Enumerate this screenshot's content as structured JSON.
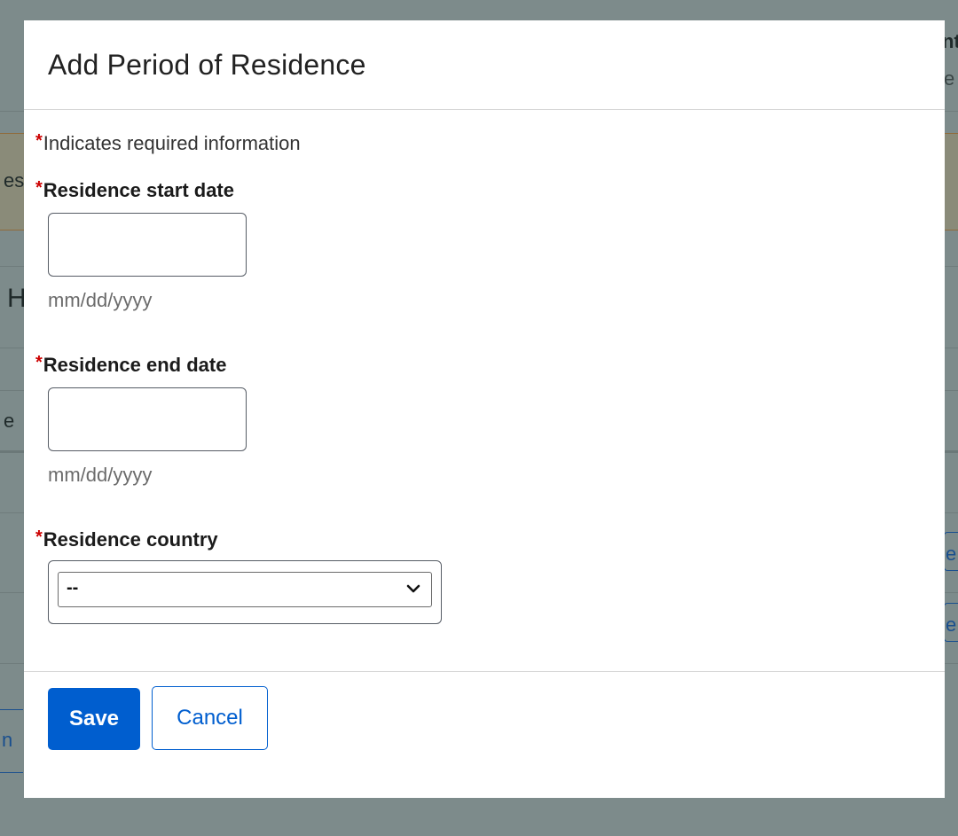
{
  "background": {
    "text_fragments": {
      "top_right_1": "nt",
      "top_right_2": "e",
      "left_band": "es",
      "left_mid": "H",
      "left_lower": "e",
      "right_link_1": "e",
      "right_link_2": "e",
      "left_link": "n"
    }
  },
  "modal": {
    "title": "Add Period of Residence",
    "required_asterisk": "*",
    "required_note": "Indicates required information",
    "fields": {
      "start_date": {
        "label": "Residence start date",
        "value": "",
        "hint": "mm/dd/yyyy"
      },
      "end_date": {
        "label": "Residence end date",
        "value": "",
        "hint": "mm/dd/yyyy"
      },
      "country": {
        "label": "Residence country",
        "selected": "--"
      }
    },
    "buttons": {
      "save": "Save",
      "cancel": "Cancel"
    }
  },
  "colors": {
    "overlay": "#7d8b8b",
    "primary": "#005ecf",
    "required": "#cc0000"
  },
  "icons": {
    "select_chevron": "chevron-down-icon"
  }
}
